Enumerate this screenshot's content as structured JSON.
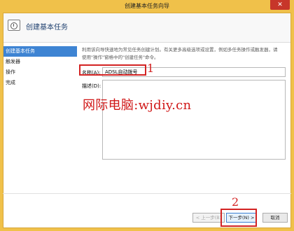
{
  "window": {
    "title": "创建基本任务向导",
    "close_glyph": "✕"
  },
  "header": {
    "title": "创建基本任务",
    "icon": "task-scheduler-icon"
  },
  "sidebar": {
    "items": [
      {
        "label": "创建基本任务",
        "active": true
      },
      {
        "label": "触发器",
        "active": false
      },
      {
        "label": "操作",
        "active": false
      },
      {
        "label": "完成",
        "active": false
      }
    ]
  },
  "main": {
    "description": "利用该向导快速地为常见任务创建计划。有关更多高级选项或设置，例如多任务操作或触发器，请使用\"操作\"窗格中的\"创建任务\"命令。",
    "name_label": "名称(A):",
    "name_value": "ADSL自动拨号",
    "desc_label": "描述(D):",
    "desc_value": ""
  },
  "buttons": {
    "back": "< 上一步(B)",
    "next": "下一步(N) >",
    "cancel": "取消"
  },
  "annotations": {
    "marker1": "1",
    "marker2": "2"
  },
  "watermark": "网际电脑:wjdiy.cn"
}
